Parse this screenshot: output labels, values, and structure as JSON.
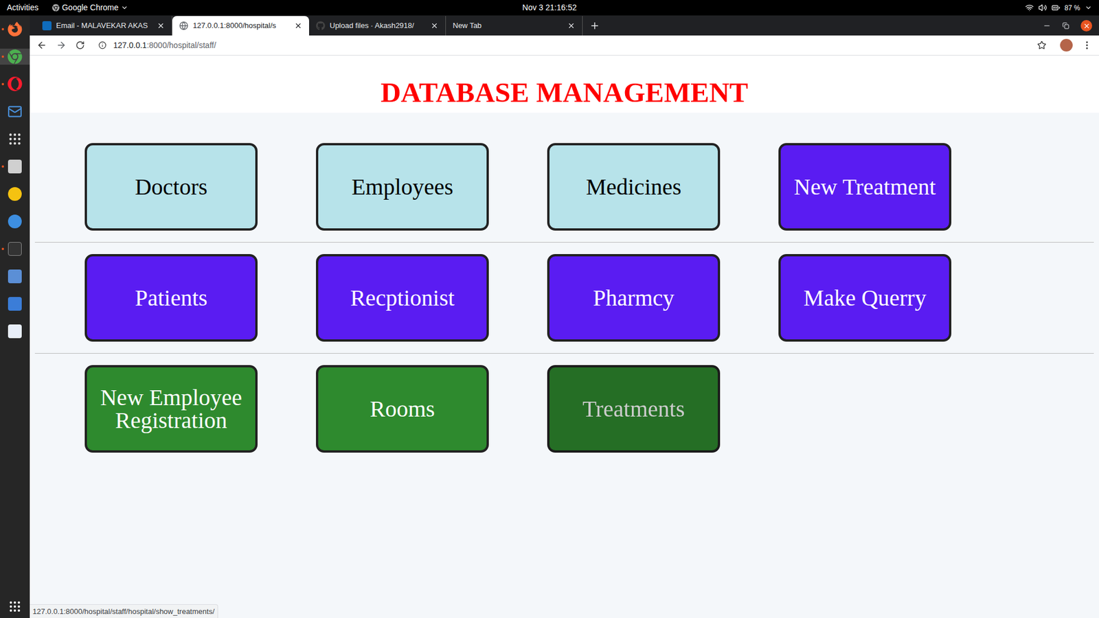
{
  "topbar": {
    "activities": "Activities",
    "app_menu": "Google Chrome",
    "clock": "Nov 3  21:16:52",
    "battery": "87 %"
  },
  "tabs": [
    {
      "label": "Email - MALAVEKAR AKAS",
      "selected": false
    },
    {
      "label": "127.0.0.1:8000/hospital/s",
      "selected": true
    },
    {
      "label": "Upload files · Akash2918/",
      "selected": false
    },
    {
      "label": "New Tab",
      "selected": false
    }
  ],
  "address": {
    "host": "127.0.0.1",
    "path": ":8000/hospital/staff/"
  },
  "page": {
    "heading": "DATABASE MANAGEMENT",
    "rows": [
      [
        {
          "label": "Doctors",
          "color": "#b7e3ea",
          "hovered": false
        },
        {
          "label": "Employees",
          "color": "#b7e3ea",
          "hovered": false
        },
        {
          "label": "Medicines",
          "color": "#b7e3ea",
          "hovered": false
        },
        {
          "label": "New Treatment",
          "color": "#5a1cf2",
          "hovered": false
        }
      ],
      [
        {
          "label": "Patients",
          "color": "#5a1cf2",
          "hovered": false
        },
        {
          "label": "Recptionist",
          "color": "#5a1cf2",
          "hovered": false
        },
        {
          "label": "Pharmcy",
          "color": "#5a1cf2",
          "hovered": false
        },
        {
          "label": "Make Querry",
          "color": "#5a1cf2",
          "hovered": false
        }
      ],
      [
        {
          "label": "New Employee Registration",
          "color": "#2e8a2e",
          "hovered": false
        },
        {
          "label": "Rooms",
          "color": "#2e8a2e",
          "hovered": false
        },
        {
          "label": "Treatments",
          "color": "#2e8a2e",
          "hovered": true
        }
      ]
    ]
  },
  "status_bar": "127.0.0.1:8000/hospital/staff/hospital/show_treatments/"
}
